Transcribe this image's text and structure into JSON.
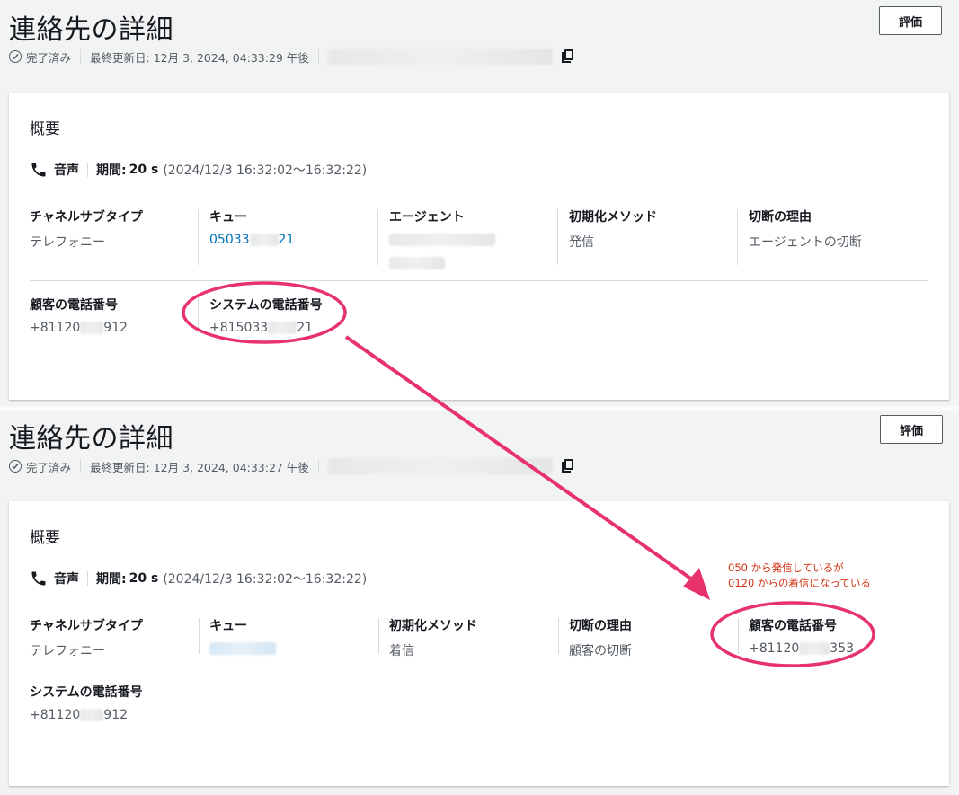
{
  "top": {
    "title": "連絡先の詳細",
    "status": "完了済み",
    "last_updated": "最終更新日: 12月 3, 2024, 04:33:29 午後",
    "eval_button": "評価",
    "card": {
      "heading": "概要",
      "channel_label": "音声",
      "duration_key": "期間:",
      "duration_value": "20 s",
      "duration_range": "(2024/12/3 16:32:02～16:32:22)",
      "fields": [
        {
          "key": "チャネルサブタイプ",
          "value": "テレフォニー"
        },
        {
          "key": "キュー",
          "value_prefix": "05033",
          "value_suffix": "21"
        },
        {
          "key": "エージェント",
          "value": ""
        },
        {
          "key": "初期化メソッド",
          "value": "発信"
        },
        {
          "key": "切断の理由",
          "value": "エージェントの切断"
        }
      ],
      "fields_row2": [
        {
          "key": "顧客の電話番号",
          "value_prefix": "+81120",
          "value_suffix": "912"
        },
        {
          "key": "システムの電話番号",
          "value_prefix": "+815033",
          "value_suffix": "21"
        }
      ]
    }
  },
  "bottom": {
    "title": "連絡先の詳細",
    "status": "完了済み",
    "last_updated": "最終更新日: 12月 3, 2024, 04:33:27 午後",
    "eval_button": "評価",
    "card": {
      "heading": "概要",
      "channel_label": "音声",
      "duration_key": "期間:",
      "duration_value": "20 s",
      "duration_range": "(2024/12/3 16:32:02～16:32:22)",
      "fields": [
        {
          "key": "チャネルサブタイプ",
          "value": "テレフォニー"
        },
        {
          "key": "キュー",
          "value": ""
        },
        {
          "key": "初期化メソッド",
          "value": "着信"
        },
        {
          "key": "切断の理由",
          "value": "顧客の切断"
        },
        {
          "key": "顧客の電話番号",
          "value_prefix": "+81120",
          "value_suffix": "353"
        }
      ],
      "fields_row2": [
        {
          "key": "システムの電話番号",
          "value_prefix": "+81120",
          "value_suffix": "912"
        }
      ]
    },
    "annotation": {
      "line1": "050 から発信しているが",
      "line2": "0120 からの着信になっている"
    }
  },
  "colors": {
    "annotation_red": "#e8326c",
    "link_blue": "#0073bb"
  },
  "icons": [
    "check-circle-icon",
    "copy-icon",
    "phone-icon"
  ]
}
